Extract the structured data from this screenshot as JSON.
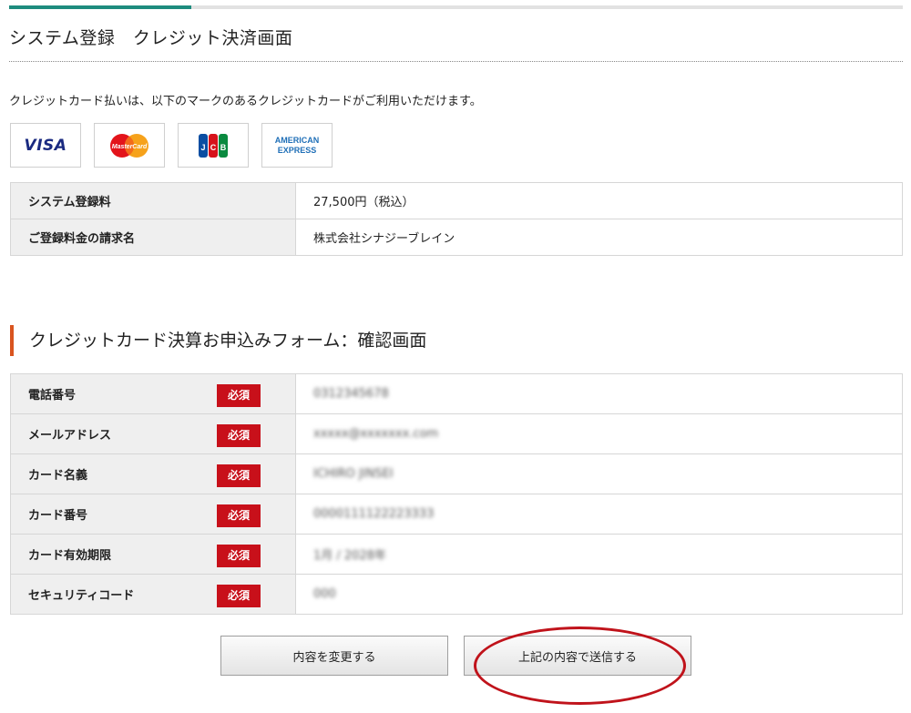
{
  "header": {
    "title": "システム登録　クレジット決済画面"
  },
  "intro": "クレジットカード払いは、以下のマークのあるクレジットカードがご利用いただけます。",
  "card_brands": [
    {
      "name": "VISA",
      "icon": "visa-logo-icon"
    },
    {
      "name": "MasterCard",
      "icon": "mastercard-logo-icon"
    },
    {
      "name": "JCB",
      "icon": "jcb-logo-icon"
    },
    {
      "name": "AMERICAN EXPRESS",
      "line1": "AMERICAN",
      "line2": "EXPRESS",
      "icon": "amex-logo-icon"
    }
  ],
  "fee_table": [
    {
      "label": "システム登録料",
      "value": "27,500円（税込）"
    },
    {
      "label": "ご登録料金の請求名",
      "value": "株式会社シナジーブレイン"
    }
  ],
  "form_section": {
    "title": "クレジットカード決算お申込みフォーム：確認画面"
  },
  "required_label": "必須",
  "form_rows": [
    {
      "label": "電話番号",
      "value": "0312345678"
    },
    {
      "label": "メールアドレス",
      "value": "xxxxx@xxxxxxx.com"
    },
    {
      "label": "カード名義",
      "value": "ICHIRO JINSEI"
    },
    {
      "label": "カード番号",
      "value": "0000111122223333"
    },
    {
      "label": "カード有効期限",
      "value": "1月 / 2028年"
    },
    {
      "label": "セキュリティコード",
      "value": "000"
    }
  ],
  "buttons": {
    "change": "内容を変更する",
    "submit": "上記の内容で送信する"
  },
  "colors": {
    "accent_bar": "#1e8c7e",
    "section_marker": "#d9541f",
    "required_badge": "#c8101a",
    "annotation_ring": "#c0131b"
  }
}
